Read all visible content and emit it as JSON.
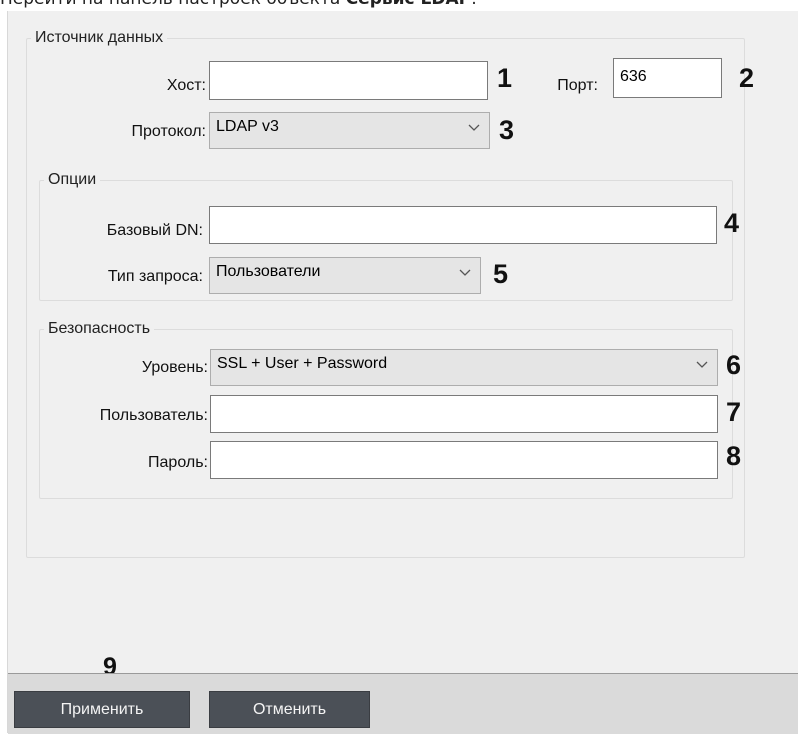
{
  "caption": {
    "prefix": "Перейти на панель настроек объекта ",
    "object": "Сервис LDAP"
  },
  "source": {
    "legend": "Источник данных",
    "host_label": "Хост:",
    "host_value": "",
    "port_label": "Порт:",
    "port_value": "636",
    "protocol_label": "Протокол:",
    "protocol_value": "LDAP v3"
  },
  "options": {
    "legend": "Опции",
    "base_dn_label": "Базовый DN:",
    "base_dn_value": "",
    "query_type_label": "Тип запроса:",
    "query_type_value": "Пользователи"
  },
  "security": {
    "legend": "Безопасность",
    "level_label": "Уровень:",
    "level_value": "SSL + User + Password",
    "user_label": "Пользователь:",
    "user_value": "",
    "password_label": "Пароль:",
    "password_value": ""
  },
  "callouts": [
    "1",
    "2",
    "3",
    "4",
    "5",
    "6",
    "7",
    "8",
    "9"
  ],
  "buttons": {
    "apply": "Применить",
    "cancel": "Отменить"
  },
  "icons": {
    "dropdown": "chevron-down-icon"
  }
}
